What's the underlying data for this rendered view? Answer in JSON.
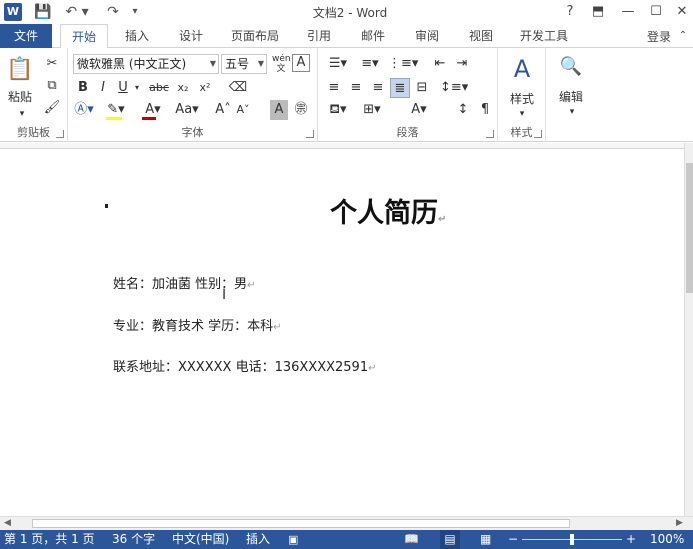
{
  "window": {
    "title": "文档2 - Word",
    "help": "?",
    "controls": [
      "ribbon-display",
      "minimize",
      "maximize",
      "close"
    ]
  },
  "tabs": {
    "file": "文件",
    "items": [
      "开始",
      "插入",
      "设计",
      "页面布局",
      "引用",
      "邮件",
      "审阅",
      "视图",
      "开发工具"
    ],
    "active": "开始",
    "login": "登录"
  },
  "ribbon": {
    "clipboard": {
      "label": "剪贴板",
      "paste": "粘贴"
    },
    "font": {
      "label": "字体",
      "font_name": "微软雅黑 (中文正文)",
      "font_size": "五号",
      "bold": "B",
      "italic": "I",
      "underline": "U",
      "strike": "abc",
      "subscript": "x₂",
      "superscript": "x²",
      "phonetic": "wén",
      "grow": "A",
      "shrink": "A",
      "case": "Aa"
    },
    "paragraph": {
      "label": "段落"
    },
    "styles": {
      "label": "样式",
      "button": "样式"
    },
    "editing": {
      "button": "编辑"
    }
  },
  "document": {
    "title": "个人简历",
    "lines": [
      "姓名：加油菌  性别：男",
      "专业：教育技术  学历：本科",
      "联系地址：XXXXXX  电话：136XXXX2591"
    ]
  },
  "status": {
    "page": "第 1 页，共 1 页",
    "words": "36 个字",
    "language": "中文(中国)",
    "mode": "插入",
    "zoom": "100%"
  },
  "colors": {
    "brand": "#2b579a",
    "highlight": "#ffff00",
    "font_color": "#c00000"
  }
}
